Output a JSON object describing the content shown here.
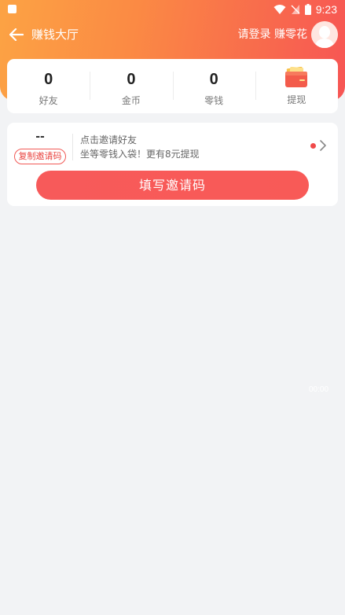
{
  "status_bar": {
    "time": "9:23"
  },
  "nav": {
    "title": "赚钱大厅",
    "login_text": "请登录 赚零花"
  },
  "stats": [
    {
      "value": "0",
      "label": "好友"
    },
    {
      "value": "0",
      "label": "金币"
    },
    {
      "value": "0",
      "label": "零钱"
    },
    {
      "label": "提现",
      "icon": "wallet-icon"
    }
  ],
  "invite": {
    "code": "--",
    "copy_label": "复制邀请码",
    "title": "点击邀请好友",
    "desc": "坐等零钱入袋！更有8元提现",
    "button_label": "填写邀请码"
  },
  "overlay": {
    "time_text": "00:00"
  },
  "colors": {
    "header_start": "#fca344",
    "header_end": "#f75554",
    "accent_red": "#f75a5a",
    "background": "#f2f3f5"
  }
}
